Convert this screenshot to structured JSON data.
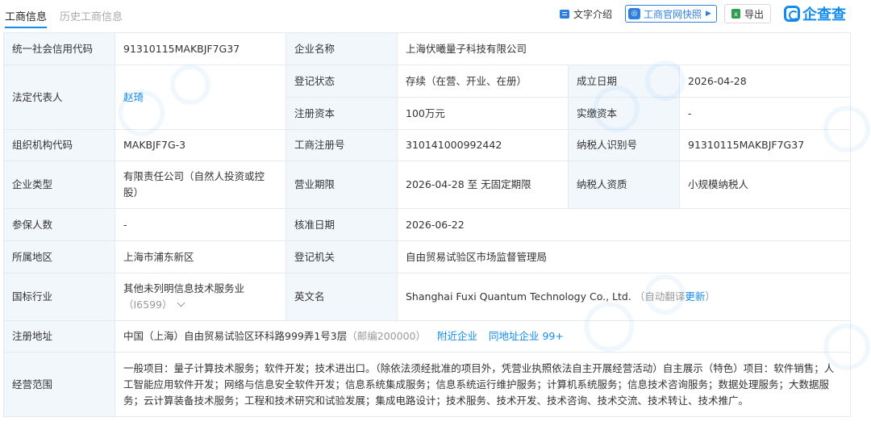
{
  "tabs": [
    "工商信息",
    "历史工商信息"
  ],
  "toolbar": {
    "text_intro": "文字介绍",
    "official_snapshot": "工商官网快照",
    "export": "导出",
    "brand": "企查查"
  },
  "colors": {
    "accent": "#128bed",
    "label_bg": "#f2f7fc",
    "border": "#e4eaf2"
  },
  "icons": [
    "text-icon",
    "snapshot-icon",
    "excel-icon",
    "qcc-logo-icon",
    "chevron-down-icon"
  ],
  "info": {
    "credit_code_label": "统一社会信用代码",
    "credit_code": "91310115MAKBJF7G37",
    "company_name_label": "企业名称",
    "company_name": "上海伏曦量子科技有限公司",
    "legal_rep_label": "法定代表人",
    "legal_rep": "赵琦",
    "reg_status_label": "登记状态",
    "reg_status": "存续（在营、开业、在册）",
    "founded_label": "成立日期",
    "founded": "2026-04-28",
    "reg_capital_label": "注册资本",
    "reg_capital": "100万元",
    "paid_capital_label": "实缴资本",
    "paid_capital": "-",
    "org_code_label": "组织机构代码",
    "org_code": "MAKBJF7G-3",
    "biz_reg_no_label": "工商注册号",
    "biz_reg_no": "310141000992442",
    "taxpayer_id_label": "纳税人识别号",
    "taxpayer_id": "91310115MAKBJF7G37",
    "company_type_label": "企业类型",
    "company_type": "有限责任公司（自然人投资或控股）",
    "biz_term_label": "营业期限",
    "biz_term": "2026-04-28 至 无固定期限",
    "taxpayer_qual_label": "纳税人资质",
    "taxpayer_qual": "小规模纳税人",
    "insured_label": "参保人数",
    "insured": "-",
    "approval_date_label": "核准日期",
    "approval_date": "2026-06-22",
    "region_label": "所属地区",
    "region": "上海市浦东新区",
    "reg_authority_label": "登记机关",
    "reg_authority": "自由贸易试验区市场监督管理局",
    "industry_label": "国标行业",
    "industry": "其他未列明信息技术服务业",
    "industry_code": "（I6599）",
    "english_name_label": "英文名",
    "english_name": "Shanghai Fuxi Quantum Technology Co., Ltd.",
    "auto_translate": "（自动翻译",
    "update": "更新",
    "close_paren": "）",
    "address_label": "注册地址",
    "address": "中国（上海）自由贸易试验区环科路999弄1号3层",
    "postcode": "（邮编200000）",
    "nearby": "附近企业",
    "same_address": "同地址企业 99+",
    "scope_label": "经营范围",
    "scope": "一般项目：量子计算技术服务；软件开发；技术进出口。（除依法须经批准的项目外，凭营业执照依法自主开展经营活动）自主展示（特色）项目：软件销售；人工智能应用软件开发；网络与信息安全软件开发；信息系统集成服务；信息系统运行维护服务；计算机系统服务；信息技术咨询服务；数据处理服务；大数据服务；云计算装备技术服务；工程和技术研究和试验发展；集成电路设计；技术服务、技术开发、技术咨询、技术交流、技术转让、技术推广。"
  }
}
